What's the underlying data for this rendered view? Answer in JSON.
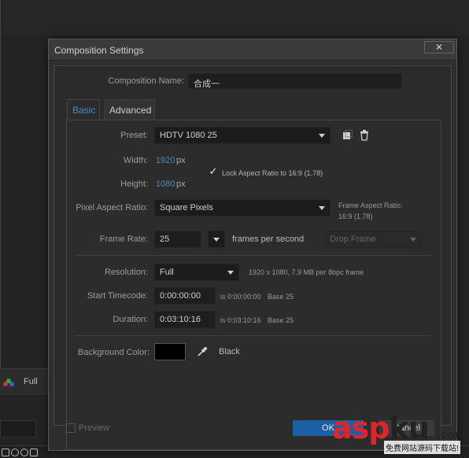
{
  "background": {
    "view_mode": "Full"
  },
  "dialog": {
    "title": "Composition Settings",
    "close_symbol": "✕",
    "composition_name_label": "Composition Name:",
    "composition_name_value": "合成一",
    "tabs": [
      {
        "label": "Basic",
        "active": true
      },
      {
        "label": "Advanced",
        "active": false
      }
    ],
    "preset": {
      "label": "Preset:",
      "value": "HDTV 1080 25"
    },
    "width": {
      "label": "Width:",
      "value": "1920",
      "unit": "px"
    },
    "height": {
      "label": "Height:",
      "value": "1080",
      "unit": "px"
    },
    "lock_aspect": {
      "label": "Lock Aspect Ratio to 16:9 (1.78)",
      "checked": true,
      "check_symbol": "✓"
    },
    "pixel_aspect": {
      "label": "Pixel Aspect Ratio:",
      "value": "Square Pixels"
    },
    "frame_aspect": {
      "label": "Frame Aspect Ratio:",
      "value": "16:9 (1.78)"
    },
    "frame_rate": {
      "label": "Frame Rate:",
      "value": "25",
      "unit": "frames per second",
      "drop_frame": "Drop Frame"
    },
    "resolution": {
      "label": "Resolution:",
      "value": "Full",
      "info": "1920 x 1080, 7.9 MB per 8bpc frame"
    },
    "start_timecode": {
      "label": "Start Timecode:",
      "value": "0:00:00:00",
      "equiv": "is 0:00:00:00",
      "base": "Base 25"
    },
    "duration": {
      "label": "Duration:",
      "value": "0:03:10:16",
      "equiv": "is 0:03:10:16",
      "base": "Base 25"
    },
    "background_color": {
      "label": "Background Color:",
      "value": "#000000",
      "name": "Black"
    },
    "preview_label": "Preview",
    "ok_label": "OK",
    "cancel_label": "Cancel"
  },
  "watermark": {
    "brand_red": "asp",
    "brand_black": "ku",
    "suffix": ".com",
    "slogan": "免费网站源码下载站!"
  },
  "colors": {
    "accent": "#3a8fd6",
    "ok_button": "#1d5fa3",
    "watermark_red": "#e0242a"
  }
}
